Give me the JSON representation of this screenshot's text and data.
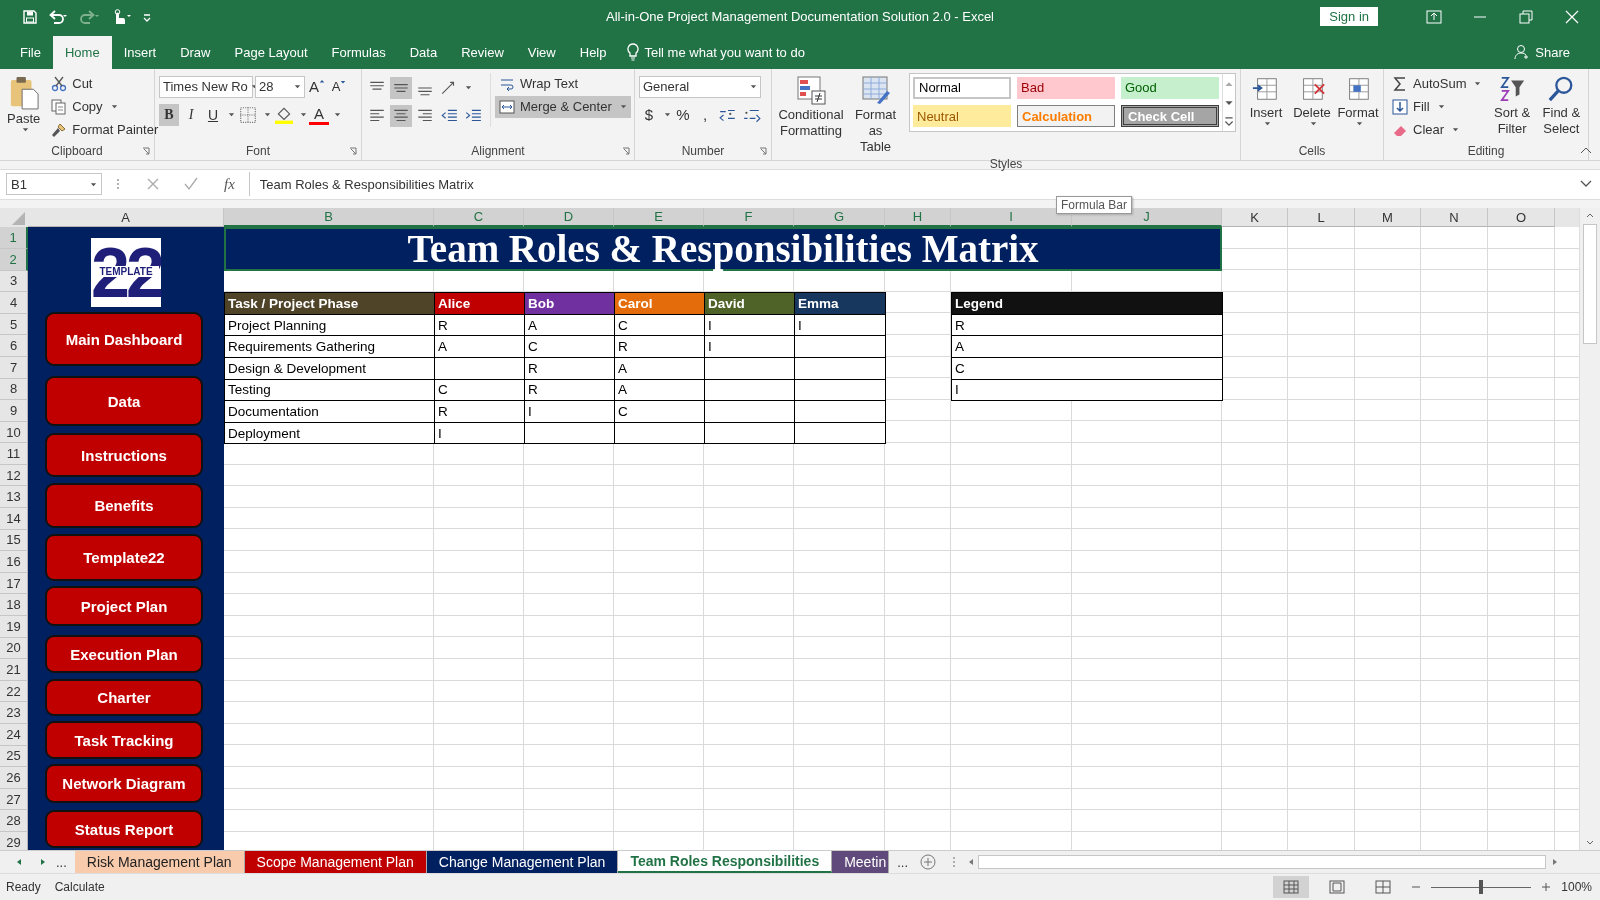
{
  "window": {
    "title": "All-in-One Project Management Documentation Solution 2.0  -  Excel",
    "sign_in": "Sign in"
  },
  "ribbon_tabs": [
    {
      "label": "File",
      "selected": false
    },
    {
      "label": "Home",
      "selected": true
    },
    {
      "label": "Insert",
      "selected": false
    },
    {
      "label": "Draw",
      "selected": false
    },
    {
      "label": "Page Layout",
      "selected": false
    },
    {
      "label": "Formulas",
      "selected": false
    },
    {
      "label": "Data",
      "selected": false
    },
    {
      "label": "Review",
      "selected": false
    },
    {
      "label": "View",
      "selected": false
    },
    {
      "label": "Help",
      "selected": false
    }
  ],
  "tell_me": "Tell me what you want to do",
  "share": "Share",
  "clipboard": {
    "paste": "Paste",
    "cut": "Cut",
    "copy": "Copy",
    "format_painter": "Format Painter",
    "group": "Clipboard"
  },
  "font": {
    "name": "Times New Ro",
    "size": "28",
    "grow": "A",
    "shrink": "A",
    "color_letter": "A",
    "group": "Font",
    "styles": [
      {
        "label": "B",
        "selected": true
      },
      {
        "label": "I",
        "selected": false
      },
      {
        "label": "U",
        "selected": false
      }
    ]
  },
  "alignment": {
    "wrap": "Wrap Text",
    "merge": "Merge & Center",
    "merge_selected": true,
    "group": "Alignment",
    "vertical": [
      {
        "selected": false
      },
      {
        "selected": true
      },
      {
        "selected": false
      }
    ],
    "horizontal": [
      {
        "selected": false
      },
      {
        "selected": true
      },
      {
        "selected": false
      }
    ]
  },
  "number": {
    "format": "General",
    "currency": "$",
    "percent": "%",
    "comma": ",",
    "group": "Number"
  },
  "styles": {
    "conditional": "Conditional Formatting",
    "format_table": "Format as Table",
    "group": "Styles",
    "cells": [
      {
        "label": "Normal",
        "kind": "normal"
      },
      {
        "label": "Bad",
        "kind": "bad"
      },
      {
        "label": "Good",
        "kind": "good"
      },
      {
        "label": "Neutral",
        "kind": "neutral"
      },
      {
        "label": "Calculation",
        "kind": "calculation"
      },
      {
        "label": "Check Cell",
        "kind": "check"
      }
    ]
  },
  "cells": {
    "buttons": [
      "Insert",
      "Delete",
      "Format"
    ],
    "group": "Cells"
  },
  "editing": {
    "autosum": "AutoSum",
    "fill": "Fill",
    "clear": "Clear",
    "sort": "Sort & Filter",
    "find": "Find & Select",
    "group": "Editing"
  },
  "formula_bar": {
    "name_box": "B1",
    "fx": "fx",
    "content": "Team Roles & Responsibilities Matrix",
    "tooltip": "Formula Bar"
  },
  "columns": [
    {
      "label": "A",
      "selected": false
    },
    {
      "label": "B",
      "selected": true
    },
    {
      "label": "C",
      "selected": true
    },
    {
      "label": "D",
      "selected": true
    },
    {
      "label": "E",
      "selected": true
    },
    {
      "label": "F",
      "selected": true
    },
    {
      "label": "G",
      "selected": true
    },
    {
      "label": "H",
      "selected": true
    },
    {
      "label": "I",
      "selected": true
    },
    {
      "label": "J",
      "selected": true
    },
    {
      "label": "K",
      "selected": false
    },
    {
      "label": "L",
      "selected": false
    },
    {
      "label": "M",
      "selected": false
    },
    {
      "label": "N",
      "selected": false
    },
    {
      "label": "O",
      "selected": false
    }
  ],
  "rows": [
    {
      "label": "1",
      "selected": true
    },
    {
      "label": "2",
      "selected": true
    },
    {
      "label": "3",
      "selected": false
    },
    {
      "label": "4",
      "selected": false
    },
    {
      "label": "5",
      "selected": false
    },
    {
      "label": "6",
      "selected": false
    },
    {
      "label": "7",
      "selected": false
    },
    {
      "label": "8",
      "selected": false
    },
    {
      "label": "9",
      "selected": false
    },
    {
      "label": "10",
      "selected": false
    },
    {
      "label": "11",
      "selected": false
    },
    {
      "label": "12",
      "selected": false
    },
    {
      "label": "13",
      "selected": false
    },
    {
      "label": "14",
      "selected": false
    },
    {
      "label": "15",
      "selected": false
    },
    {
      "label": "16",
      "selected": false
    },
    {
      "label": "17",
      "selected": false
    },
    {
      "label": "18",
      "selected": false
    },
    {
      "label": "19",
      "selected": false
    },
    {
      "label": "20",
      "selected": false
    },
    {
      "label": "21",
      "selected": false
    },
    {
      "label": "22",
      "selected": false
    },
    {
      "label": "23",
      "selected": false
    },
    {
      "label": "24",
      "selected": false
    },
    {
      "label": "25",
      "selected": false
    },
    {
      "label": "26",
      "selected": false
    },
    {
      "label": "27",
      "selected": false
    },
    {
      "label": "28",
      "selected": false
    },
    {
      "label": "29",
      "selected": false
    }
  ],
  "logo": {
    "number": "22",
    "word": "TEMPLATE"
  },
  "nav": [
    "Main Dashboard",
    "Data",
    "Instructions",
    "Benefits",
    "Template22",
    "Project Plan",
    "Execution Plan",
    "Charter",
    "Task Tracking",
    "Network Diagram",
    "Status Report"
  ],
  "title": "Team Roles & Responsibilities Matrix",
  "matrix": {
    "header": [
      {
        "label": "Task / Project Phase",
        "color": "#4f4328"
      },
      {
        "label": "Alice",
        "color": "#c00000"
      },
      {
        "label": "Bob",
        "color": "#7030a0"
      },
      {
        "label": "Carol",
        "color": "#e46c0a"
      },
      {
        "label": "David",
        "color": "#4f6228"
      },
      {
        "label": "Emma",
        "color": "#17375e"
      }
    ],
    "rows": [
      [
        "Project Planning",
        "R",
        "A",
        "C",
        "I",
        "I"
      ],
      [
        "Requirements Gathering",
        "A",
        "C",
        "R",
        "I",
        null
      ],
      [
        "Design & Development",
        null,
        "R",
        "A",
        null,
        null
      ],
      [
        "Testing",
        "C",
        "R",
        "A",
        null,
        null
      ],
      [
        "Documentation",
        "R",
        "I",
        "C",
        null,
        null
      ],
      [
        "Deployment",
        "I",
        null,
        null,
        null,
        null
      ]
    ]
  },
  "legend": {
    "title": "Legend",
    "items": [
      "R",
      "A",
      "C",
      "I"
    ]
  },
  "sheet_tabs": {
    "more_left": "...",
    "more_right": "...",
    "tabs": [
      {
        "label": "Risk Management Plan",
        "color": "#f8cbad",
        "selected": false
      },
      {
        "label": "Scope Management Plan",
        "color": "#c00000",
        "selected": false
      },
      {
        "label": "Change Management Plan",
        "color": "#002060",
        "selected": false
      },
      {
        "label": "Team Roles Responsibilities",
        "color": "#ffffff",
        "selected": true
      },
      {
        "label": "Meetin",
        "color": "#604a7b",
        "selected": false
      }
    ]
  },
  "status": {
    "ready": "Ready",
    "calculate": "Calculate",
    "zoom": "100%",
    "zoom_slider": {
      "level": 0.5
    },
    "views": [
      {
        "selected": true
      },
      {
        "selected": false
      },
      {
        "selected": false
      }
    ]
  }
}
